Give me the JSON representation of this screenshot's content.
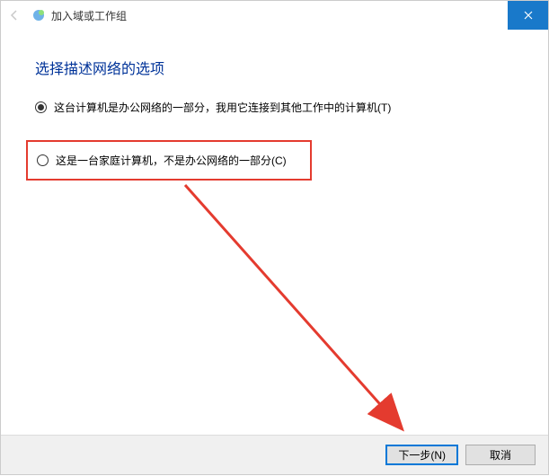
{
  "window": {
    "title": "加入域或工作组"
  },
  "heading": "选择描述网络的选项",
  "options": {
    "office": "这台计算机是办公网络的一部分，我用它连接到其他工作中的计算机(T)",
    "home": "这是一台家庭计算机，不是办公网络的一部分(C)"
  },
  "footer": {
    "next": "下一步(N)",
    "cancel": "取消"
  }
}
